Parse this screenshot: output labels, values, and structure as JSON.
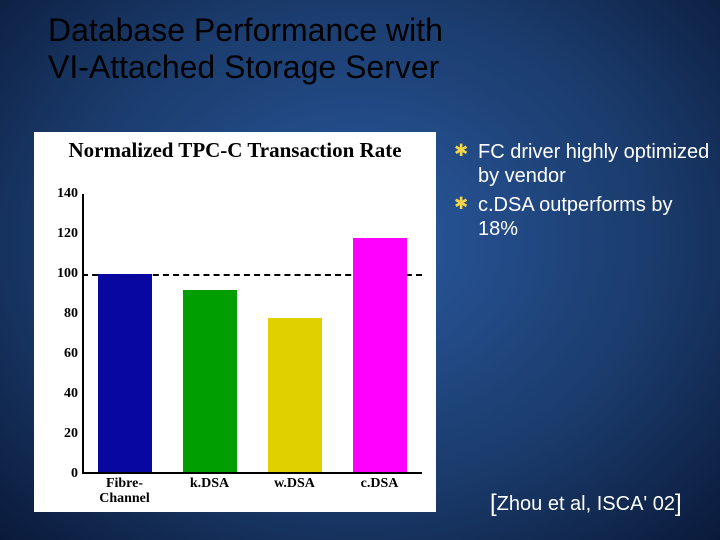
{
  "title_line1": "Database Performance with",
  "title_line2": "VI-Attached Storage Server",
  "chart_data": {
    "type": "bar",
    "title": "Normalized TPC-C Transaction Rate",
    "categories": [
      "Fibre-Channel",
      "k.DSA",
      "w.DSA",
      "c.DSA"
    ],
    "values": [
      100,
      92,
      78,
      118
    ],
    "colors": [
      "#0808a0",
      "#009e00",
      "#e0d000",
      "#ff00ff"
    ],
    "ylabel": "",
    "xlabel": "",
    "ylim": [
      0,
      140
    ],
    "yticks": [
      0,
      20,
      40,
      60,
      80,
      100,
      120,
      140
    ],
    "reference_line": 100
  },
  "bullets": [
    "FC driver highly optimized by vendor",
    "c.DSA outperforms by 18%"
  ],
  "bullet_glyph": "✱",
  "citation": {
    "open": "[",
    "text": "Zhou et al, ISCA' 02",
    "close": "]"
  }
}
